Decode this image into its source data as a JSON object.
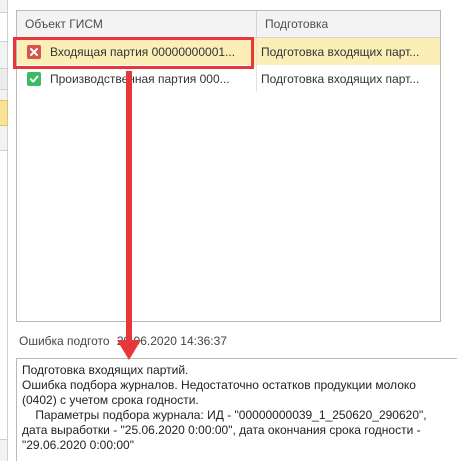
{
  "table": {
    "columns": [
      "Объект ГИСМ",
      "Подготовка"
    ],
    "rows": [
      {
        "object": "Входящая партия 00000000001...",
        "preparation": "Подготовка входящих парт...",
        "status_icon": "error-x-icon",
        "selected": true
      },
      {
        "object": "Производственная партия 000...",
        "preparation": "Подготовка входящих парт...",
        "status_icon": "check-icon",
        "selected": false
      }
    ]
  },
  "status": {
    "label": "Ошибка подготовки:",
    "label_visible": "Ошибка подгото",
    "timestamp": "29.06.2020 14:36:37"
  },
  "message": {
    "line1": "Подготовка входящих партий.",
    "line2": "Ошибка подбора журналов. Недостаточно остатков продукции молоко (0402) с учетом срока годности.",
    "line3": "    Параметры подбора журнала: ИД - \"00000000039_1_250620_290620\", дата выработки - \"25.06.2020 0:00:00\", дата окончания срока годности - \"29.06.2020 0:00:00\""
  },
  "colors": {
    "highlight": "#e8373c",
    "selected_row": "#fbeeb7",
    "error_icon": "#d9534f",
    "ok_icon": "#3dbb63"
  }
}
